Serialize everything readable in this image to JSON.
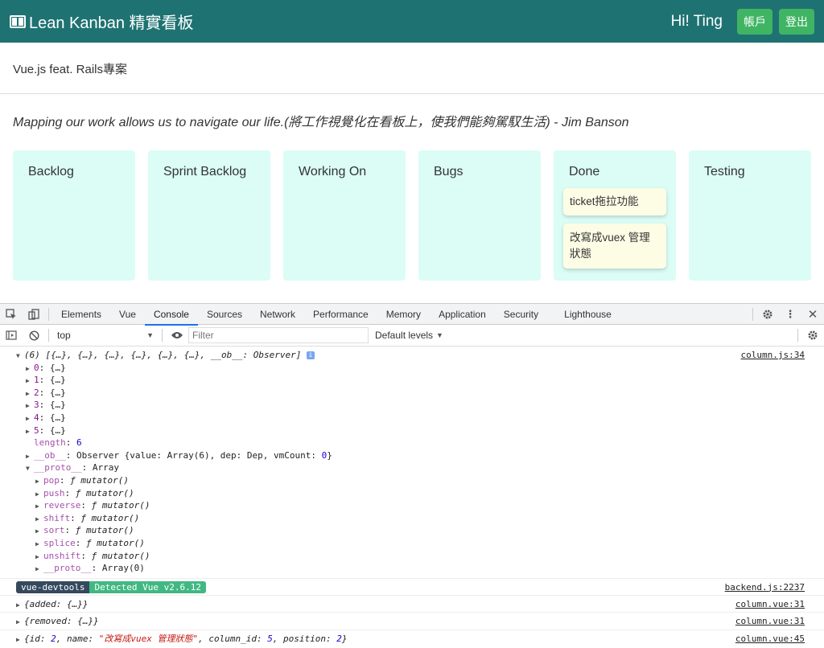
{
  "navbar": {
    "brand": "Lean Kanban 精實看板",
    "greeting": "Hi! Ting",
    "account_label": "帳戶",
    "logout_label": "登出",
    "accent": "#1f7272",
    "button_color": "#3fb564"
  },
  "project": {
    "name": "Vue.js feat. Rails專案",
    "quote": "Mapping our work allows us to navigate our life.(將工作視覺化在看板上，使我們能夠駕馭生活) - Jim Banson"
  },
  "columns": [
    {
      "name": "Backlog",
      "tickets": []
    },
    {
      "name": "Sprint Backlog",
      "tickets": []
    },
    {
      "name": "Working On",
      "tickets": []
    },
    {
      "name": "Bugs",
      "tickets": []
    },
    {
      "name": "Done",
      "tickets": [
        "ticket拖拉功能",
        "改寫成vuex 管理狀態"
      ]
    },
    {
      "name": "Testing",
      "tickets": []
    }
  ],
  "devtools": {
    "tabs": [
      "Elements",
      "Vue",
      "Console",
      "Sources",
      "Network",
      "Performance",
      "Memory",
      "Application",
      "Security",
      "Lighthouse"
    ],
    "active_tab": "Console",
    "context": "top",
    "filter_placeholder": "Filter",
    "levels": "Default levels",
    "console": {
      "array_summary": "(6) [{…}, {…}, {…}, {…}, {…}, {…}, __ob__: Observer]",
      "array_source": "column.js:34",
      "items": [
        "0",
        "1",
        "2",
        "3",
        "4",
        "5"
      ],
      "item_value": "{…}",
      "length_key": "length",
      "length_value": "6",
      "ob_key": "__ob__",
      "ob_value_pre": "Observer {value: Array(6), dep: Dep, vmCount: ",
      "ob_value_num": "0",
      "ob_value_post": "}",
      "proto_key": "__proto__",
      "proto_value": "Array",
      "methods": [
        "pop",
        "push",
        "reverse",
        "shift",
        "sort",
        "splice",
        "unshift"
      ],
      "method_value": "ƒ mutator()",
      "inner_proto_value": "Array(0)",
      "devtools_badge": "vue-devtools",
      "detected_badge": "Detected Vue v2.6.12",
      "backend_source": "backend.js:2237",
      "added_msg": "{added: {…}}",
      "added_source": "column.vue:31",
      "removed_msg": "{removed: {…}}",
      "removed_source": "column.vue:31",
      "obj_msg_pre": "{id: ",
      "obj_id": "2",
      "obj_name_key": ", name: ",
      "obj_name": "\"改寫成vuex 管理狀態\"",
      "obj_col_key": ", column_id: ",
      "obj_col": "5",
      "obj_pos_key": ", position: ",
      "obj_pos": "2",
      "obj_end": "}",
      "obj_source": "column.vue:45"
    }
  }
}
